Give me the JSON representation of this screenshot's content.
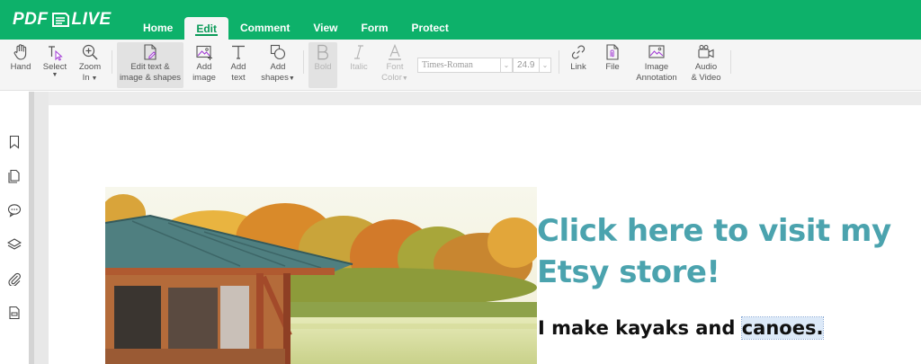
{
  "app": {
    "logo_left": "PDF",
    "logo_right": "LIVE"
  },
  "tabs": [
    {
      "label": "Home"
    },
    {
      "label": "Edit",
      "active": true
    },
    {
      "label": "Comment"
    },
    {
      "label": "View"
    },
    {
      "label": "Form"
    },
    {
      "label": "Protect"
    }
  ],
  "toolbar": {
    "hand": "Hand",
    "select": "Select",
    "zoom_1": "Zoom",
    "zoom_2": "In",
    "edit_text_1": "Edit text &",
    "edit_text_2": "image & shapes",
    "add_image_1": "Add",
    "add_image_2": "image",
    "add_text_1": "Add",
    "add_text_2": "text",
    "add_shapes_1": "Add",
    "add_shapes_2": "shapes",
    "bold": "Bold",
    "italic": "Italic",
    "font_color_1": "Font",
    "font_color_2": "Color",
    "font_family": "Times-Roman",
    "font_size": "24.9",
    "link": "Link",
    "file": "File",
    "image_annotation_1": "Image",
    "image_annotation_2": "Annotation",
    "audio_video_1": "Audio",
    "audio_video_2": "& Video"
  },
  "sidebar": [
    "bookmark-icon",
    "pages-icon",
    "comments-icon",
    "layers-icon",
    "attachment-icon",
    "form-fields-icon"
  ],
  "document": {
    "etsy_link": "Click here to visit my Etsy store!",
    "kayak_text_1": "I make kayaks and ",
    "kayak_text_2": "canoes."
  },
  "colors": {
    "brand_green": "#0db16a",
    "link_teal": "#4ba3ae"
  }
}
